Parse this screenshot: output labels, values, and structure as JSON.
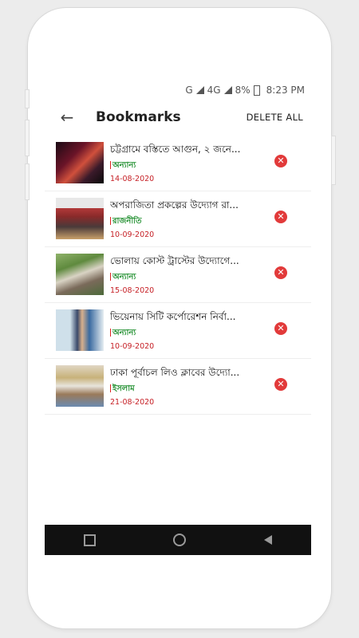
{
  "status": {
    "carrier": "G",
    "network": "4G",
    "network_small": "4G",
    "battery": "8%",
    "time": "8:23 PM"
  },
  "appbar": {
    "title": "Bookmarks",
    "delete_all": "DELETE ALL"
  },
  "items": [
    {
      "headline": "চট্টগ্রামে বস্তিতে আগুন, ২ জনে...",
      "category": "অন্যান্য",
      "date": "14-08-2020"
    },
    {
      "headline": "অপরাজিতা প্রকল্পের উদ্যোগ রা...",
      "category": "রাজনীতি",
      "date": "10-09-2020"
    },
    {
      "headline": "ভোলায় কোস্ট ট্রাস্টের উদ্যোগে...",
      "category": "অন্যান্য",
      "date": "15-08-2020"
    },
    {
      "headline": "ভিয়েনায় সিটি কর্পোরেশন নির্বা...",
      "category": "অন্যান্য",
      "date": "10-09-2020"
    },
    {
      "headline": "ঢাকা পূর্বাচল লিও ক্লাবের উদ্যো...",
      "category": "ইসলাম",
      "date": "21-08-2020"
    }
  ],
  "colors": {
    "accent": "#c62026",
    "category_green": "#1e8e2d",
    "delete_red": "#e23a3a"
  }
}
